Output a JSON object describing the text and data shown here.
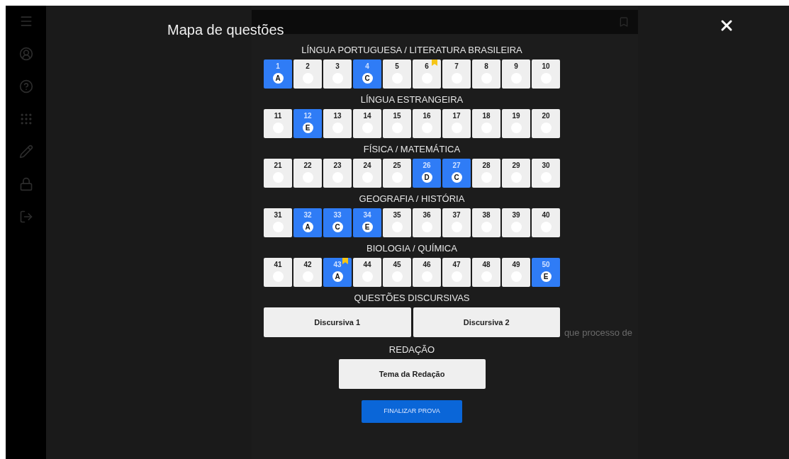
{
  "background": {
    "text": "que processo de"
  },
  "modal": {
    "title": "Mapa de questões",
    "sections": [
      {
        "title": "LÍNGUA PORTUGUESA / LITERATURA BRASILEIRA",
        "questions": [
          {
            "number": "1",
            "answered": true,
            "answer": "A",
            "flagged": false
          },
          {
            "number": "2",
            "answered": false,
            "flagged": false
          },
          {
            "number": "3",
            "answered": false,
            "flagged": false
          },
          {
            "number": "4",
            "answered": true,
            "answer": "C",
            "flagged": false
          },
          {
            "number": "5",
            "answered": false,
            "flagged": false
          },
          {
            "number": "6",
            "answered": false,
            "flagged": true
          },
          {
            "number": "7",
            "answered": false,
            "flagged": false
          },
          {
            "number": "8",
            "answered": false,
            "flagged": false
          },
          {
            "number": "9",
            "answered": false,
            "flagged": false
          },
          {
            "number": "10",
            "answered": false,
            "flagged": false
          }
        ]
      },
      {
        "title": "LÍNGUA ESTRANGEIRA",
        "questions": [
          {
            "number": "11",
            "answered": false,
            "flagged": false
          },
          {
            "number": "12",
            "answered": true,
            "answer": "E",
            "flagged": false
          },
          {
            "number": "13",
            "answered": false,
            "flagged": false
          },
          {
            "number": "14",
            "answered": false,
            "flagged": false
          },
          {
            "number": "15",
            "answered": false,
            "flagged": false
          },
          {
            "number": "16",
            "answered": false,
            "flagged": false
          },
          {
            "number": "17",
            "answered": false,
            "flagged": false
          },
          {
            "number": "18",
            "answered": false,
            "flagged": false
          },
          {
            "number": "19",
            "answered": false,
            "flagged": false
          },
          {
            "number": "20",
            "answered": false,
            "flagged": false
          }
        ]
      },
      {
        "title": "FÍSICA / MATEMÁTICA",
        "questions": [
          {
            "number": "21",
            "answered": false,
            "flagged": false
          },
          {
            "number": "22",
            "answered": false,
            "flagged": false
          },
          {
            "number": "23",
            "answered": false,
            "flagged": false
          },
          {
            "number": "24",
            "answered": false,
            "flagged": false
          },
          {
            "number": "25",
            "answered": false,
            "flagged": false
          },
          {
            "number": "26",
            "answered": true,
            "answer": "D",
            "flagged": false
          },
          {
            "number": "27",
            "answered": true,
            "answer": "C",
            "flagged": false
          },
          {
            "number": "28",
            "answered": false,
            "flagged": false
          },
          {
            "number": "29",
            "answered": false,
            "flagged": false
          },
          {
            "number": "30",
            "answered": false,
            "flagged": false
          }
        ]
      },
      {
        "title": "GEOGRAFIA / HISTÓRIA",
        "questions": [
          {
            "number": "31",
            "answered": false,
            "flagged": false
          },
          {
            "number": "32",
            "answered": true,
            "answer": "A",
            "flagged": false
          },
          {
            "number": "33",
            "answered": true,
            "answer": "C",
            "flagged": false
          },
          {
            "number": "34",
            "answered": true,
            "answer": "E",
            "flagged": false
          },
          {
            "number": "35",
            "answered": false,
            "flagged": false
          },
          {
            "number": "36",
            "answered": false,
            "flagged": false
          },
          {
            "number": "37",
            "answered": false,
            "flagged": false
          },
          {
            "number": "38",
            "answered": false,
            "flagged": false
          },
          {
            "number": "39",
            "answered": false,
            "flagged": false
          },
          {
            "number": "40",
            "answered": false,
            "flagged": false
          }
        ]
      },
      {
        "title": "BIOLOGIA / QUÍMICA",
        "questions": [
          {
            "number": "41",
            "answered": false,
            "flagged": false
          },
          {
            "number": "42",
            "answered": false,
            "flagged": false
          },
          {
            "number": "43",
            "answered": true,
            "answer": "A",
            "flagged": true
          },
          {
            "number": "44",
            "answered": false,
            "flagged": false
          },
          {
            "number": "45",
            "answered": false,
            "flagged": false
          },
          {
            "number": "46",
            "answered": false,
            "flagged": false
          },
          {
            "number": "47",
            "answered": false,
            "flagged": false
          },
          {
            "number": "48",
            "answered": false,
            "flagged": false
          },
          {
            "number": "49",
            "answered": false,
            "flagged": false
          },
          {
            "number": "50",
            "answered": true,
            "answer": "E",
            "flagged": false
          }
        ]
      }
    ],
    "discursive": {
      "title": "QUESTÕES DISCURSIVAS",
      "items": [
        "Discursiva 1",
        "Discursiva 2"
      ]
    },
    "essay": {
      "title": "REDAÇÃO",
      "item": "Tema da Redação"
    },
    "finish_button": "FINALIZAR PROVA"
  }
}
